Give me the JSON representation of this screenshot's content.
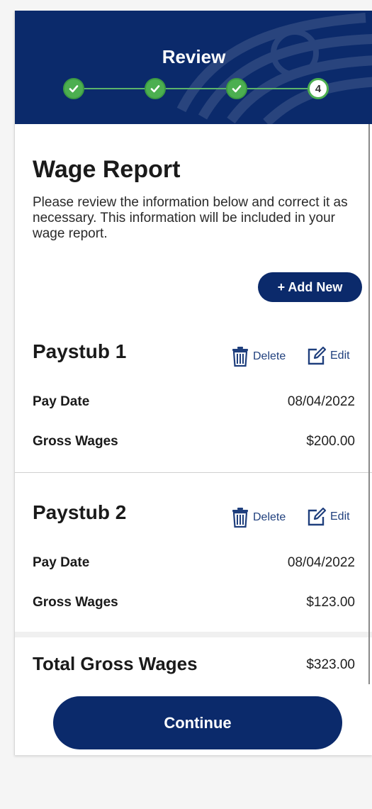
{
  "header": {
    "title": "Review",
    "steps": [
      {
        "state": "done",
        "label": ""
      },
      {
        "state": "done",
        "label": ""
      },
      {
        "state": "done",
        "label": ""
      },
      {
        "state": "current",
        "label": "4"
      }
    ]
  },
  "page": {
    "title": "Wage Report",
    "intro": "Please review the information below and correct it as necessary. This information will be included in your wage report.",
    "add_new_label": "+ Add New"
  },
  "paystubs": [
    {
      "title": "Paystub 1",
      "delete_label": "Delete",
      "edit_label": "Edit",
      "pay_date_label": "Pay Date",
      "pay_date": "08/04/2022",
      "gross_wages_label": "Gross Wages",
      "gross_wages": "$200.00"
    },
    {
      "title": "Paystub 2",
      "delete_label": "Delete",
      "edit_label": "Edit",
      "pay_date_label": "Pay Date",
      "pay_date": "08/04/2022",
      "gross_wages_label": "Gross Wages",
      "gross_wages": "$123.00"
    }
  ],
  "total": {
    "label": "Total Gross Wages",
    "value": "$323.00"
  },
  "continue_label": "Continue",
  "colors": {
    "primary": "#0b2a6b",
    "success": "#4caf50",
    "link": "#1f3f7d"
  }
}
